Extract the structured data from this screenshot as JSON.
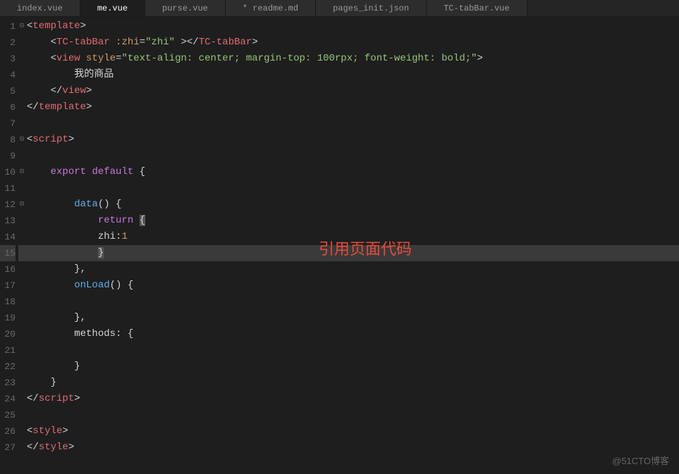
{
  "tabs": [
    {
      "label": "index.vue",
      "active": false
    },
    {
      "label": "me.vue",
      "active": true
    },
    {
      "label": "purse.vue",
      "active": false
    },
    {
      "label": "* readme.md",
      "active": false
    },
    {
      "label": "pages_init.json",
      "active": false
    },
    {
      "label": "TC-tabBar.vue",
      "active": false
    }
  ],
  "lineNumbers": [
    "1",
    "2",
    "3",
    "4",
    "5",
    "6",
    "7",
    "8",
    "9",
    "10",
    "11",
    "12",
    "13",
    "14",
    "15",
    "16",
    "17",
    "18",
    "19",
    "20",
    "21",
    "22",
    "23",
    "24",
    "25",
    "26",
    "27"
  ],
  "foldMarks": {
    "0": "⊟",
    "7": "⊟",
    "9": "⊟",
    "11": "⊟"
  },
  "tokens": {
    "template": "template",
    "tcTabBar": "TC-tabBar",
    "zhiAttr": ":zhi",
    "zhiVal": "\"zhi\"",
    "view": "view",
    "styleAttr": "style",
    "styleVal": "\"text-align: center; margin-top: 100rpx; font-weight: bold;\"",
    "myGoods": "我的商品",
    "script": "script",
    "export": "export",
    "default": "default",
    "data": "data",
    "return": "return",
    "zhiKey": "zhi",
    "one": "1",
    "onLoad": "onLoad",
    "methods": "methods",
    "style": "style"
  },
  "annotation": "引用页面代码",
  "watermark": "@51CTO博客"
}
